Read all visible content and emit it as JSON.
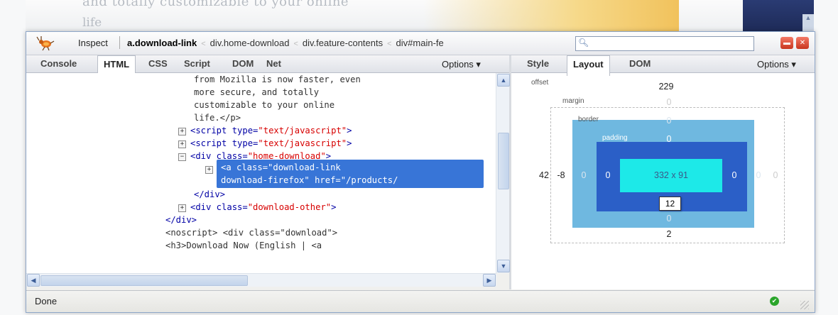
{
  "page_background": {
    "text_line_1": "and totally customizable to your online",
    "text_line_2": "life"
  },
  "toolbar": {
    "inspect_label": "Inspect",
    "breadcrumbs": [
      "a.download-link",
      "div.home-download",
      "div.feature-contents",
      "div#main-fe"
    ],
    "search_placeholder": ""
  },
  "left_panel": {
    "tabs": [
      "Console",
      "HTML",
      "CSS",
      "Script",
      "DOM",
      "Net"
    ],
    "active_tab": "HTML",
    "options_label": "Options ▾",
    "code_lines": [
      {
        "prefix": "",
        "text": "from Mozilla is now faster, even"
      },
      {
        "prefix": "",
        "text": "more secure, and totally"
      },
      {
        "prefix": "",
        "text": "customizable to your online"
      },
      {
        "prefix": "",
        "text": "life.</p>"
      },
      {
        "tag1": "<script type=",
        "val": "\"text/javascript\"",
        "tag2": ">"
      },
      {
        "tag1": "<script type=",
        "val": "\"text/javascript\"",
        "tag2": ">"
      },
      {
        "tag1": "<div class=",
        "val": "\"home-download\"",
        "tag2": ">"
      },
      {
        "text": "<a class=\"download-link"
      },
      {
        "text": "download-firefox\" href=\"/products/"
      },
      {
        "text": "</div>"
      },
      {
        "tag1": "<div class=",
        "val": "\"download-other\"",
        "tag2": ">"
      },
      {
        "text": "</div>"
      },
      {
        "text": "<noscript> <div class=\"download\">"
      },
      {
        "text": "<h3>Download Now (English | <a"
      }
    ]
  },
  "right_panel": {
    "tabs": [
      "Style",
      "Layout",
      "DOM"
    ],
    "active_tab": "Layout",
    "options_label": "Options ▾",
    "layout": {
      "offset_label": "offset",
      "offset_top": "229",
      "offset_left": "42",
      "margin_label": "margin",
      "margin_top": "0",
      "margin_left": "-8",
      "margin_right": "0",
      "margin_bottom": "2",
      "border_label": "border",
      "border_top": "0",
      "border_left": "0",
      "border_right": "0",
      "border_bottom": "0",
      "padding_label": "padding",
      "padding_top": "0",
      "padding_left": "0",
      "padding_right": "0",
      "padding_bottom": "12",
      "content_size": "332 x 91"
    }
  },
  "status_bar": {
    "text": "Done"
  },
  "colors": {
    "selection": "#3875d7",
    "tag": "#0000a5",
    "attr_value": "#d70000",
    "border_box": "#6fb8e0",
    "padding_box": "#2b5fc7",
    "content_box": "#1de9e8"
  }
}
